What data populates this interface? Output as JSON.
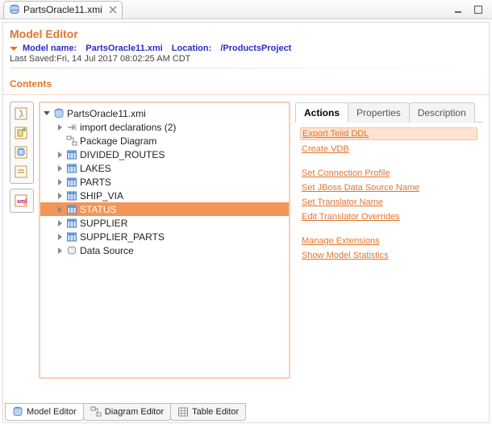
{
  "window": {
    "title": "PartsOracle11.xmi"
  },
  "editor": {
    "title": "Model Editor",
    "model_name_label": "Model name:",
    "model_name": "PartsOracle11.xmi",
    "location_label": "Location:",
    "location": "/ProductsProject",
    "last_saved_label": "Last Saved:",
    "last_saved": "Fri, 14 Jul 2017 08:02:25 AM CDT",
    "contents_label": "Contents"
  },
  "tree": {
    "root": "PartsOracle11.xmi",
    "items": [
      {
        "label": "import declarations (2)",
        "kind": "imports",
        "expandable": true
      },
      {
        "label": "Package Diagram",
        "kind": "diagram",
        "expandable": false
      },
      {
        "label": "DIVIDED_ROUTES",
        "kind": "table",
        "expandable": true
      },
      {
        "label": "LAKES",
        "kind": "table",
        "expandable": true
      },
      {
        "label": "PARTS",
        "kind": "table",
        "expandable": true
      },
      {
        "label": "SHIP_VIA",
        "kind": "table",
        "expandable": true
      },
      {
        "label": "STATUS",
        "kind": "table",
        "expandable": true,
        "selected": true
      },
      {
        "label": "SUPPLIER",
        "kind": "table",
        "expandable": true
      },
      {
        "label": "SUPPLIER_PARTS",
        "kind": "table",
        "expandable": true
      },
      {
        "label": "Data Source",
        "kind": "datasource",
        "expandable": true
      }
    ]
  },
  "tabs": {
    "actions": "Actions",
    "properties": "Properties",
    "description": "Description"
  },
  "actions": {
    "export_ddl": "Export Teiid DDL",
    "create_vdb": "Create VDB",
    "set_conn": "Set Connection Profile",
    "set_jboss": "Set JBoss Data Source Name",
    "set_translator": "Set Translator Name",
    "edit_overrides": "Edit Translator Overrides",
    "manage_ext": "Manage Extensions",
    "show_stats": "Show Model Statistics"
  },
  "bottom_tabs": {
    "model_editor": "Model Editor",
    "diagram_editor": "Diagram Editor",
    "table_editor": "Table Editor"
  },
  "colors": {
    "accent": "#e5742a",
    "link_blue": "#2b2bc9",
    "selection": "#f49558"
  }
}
